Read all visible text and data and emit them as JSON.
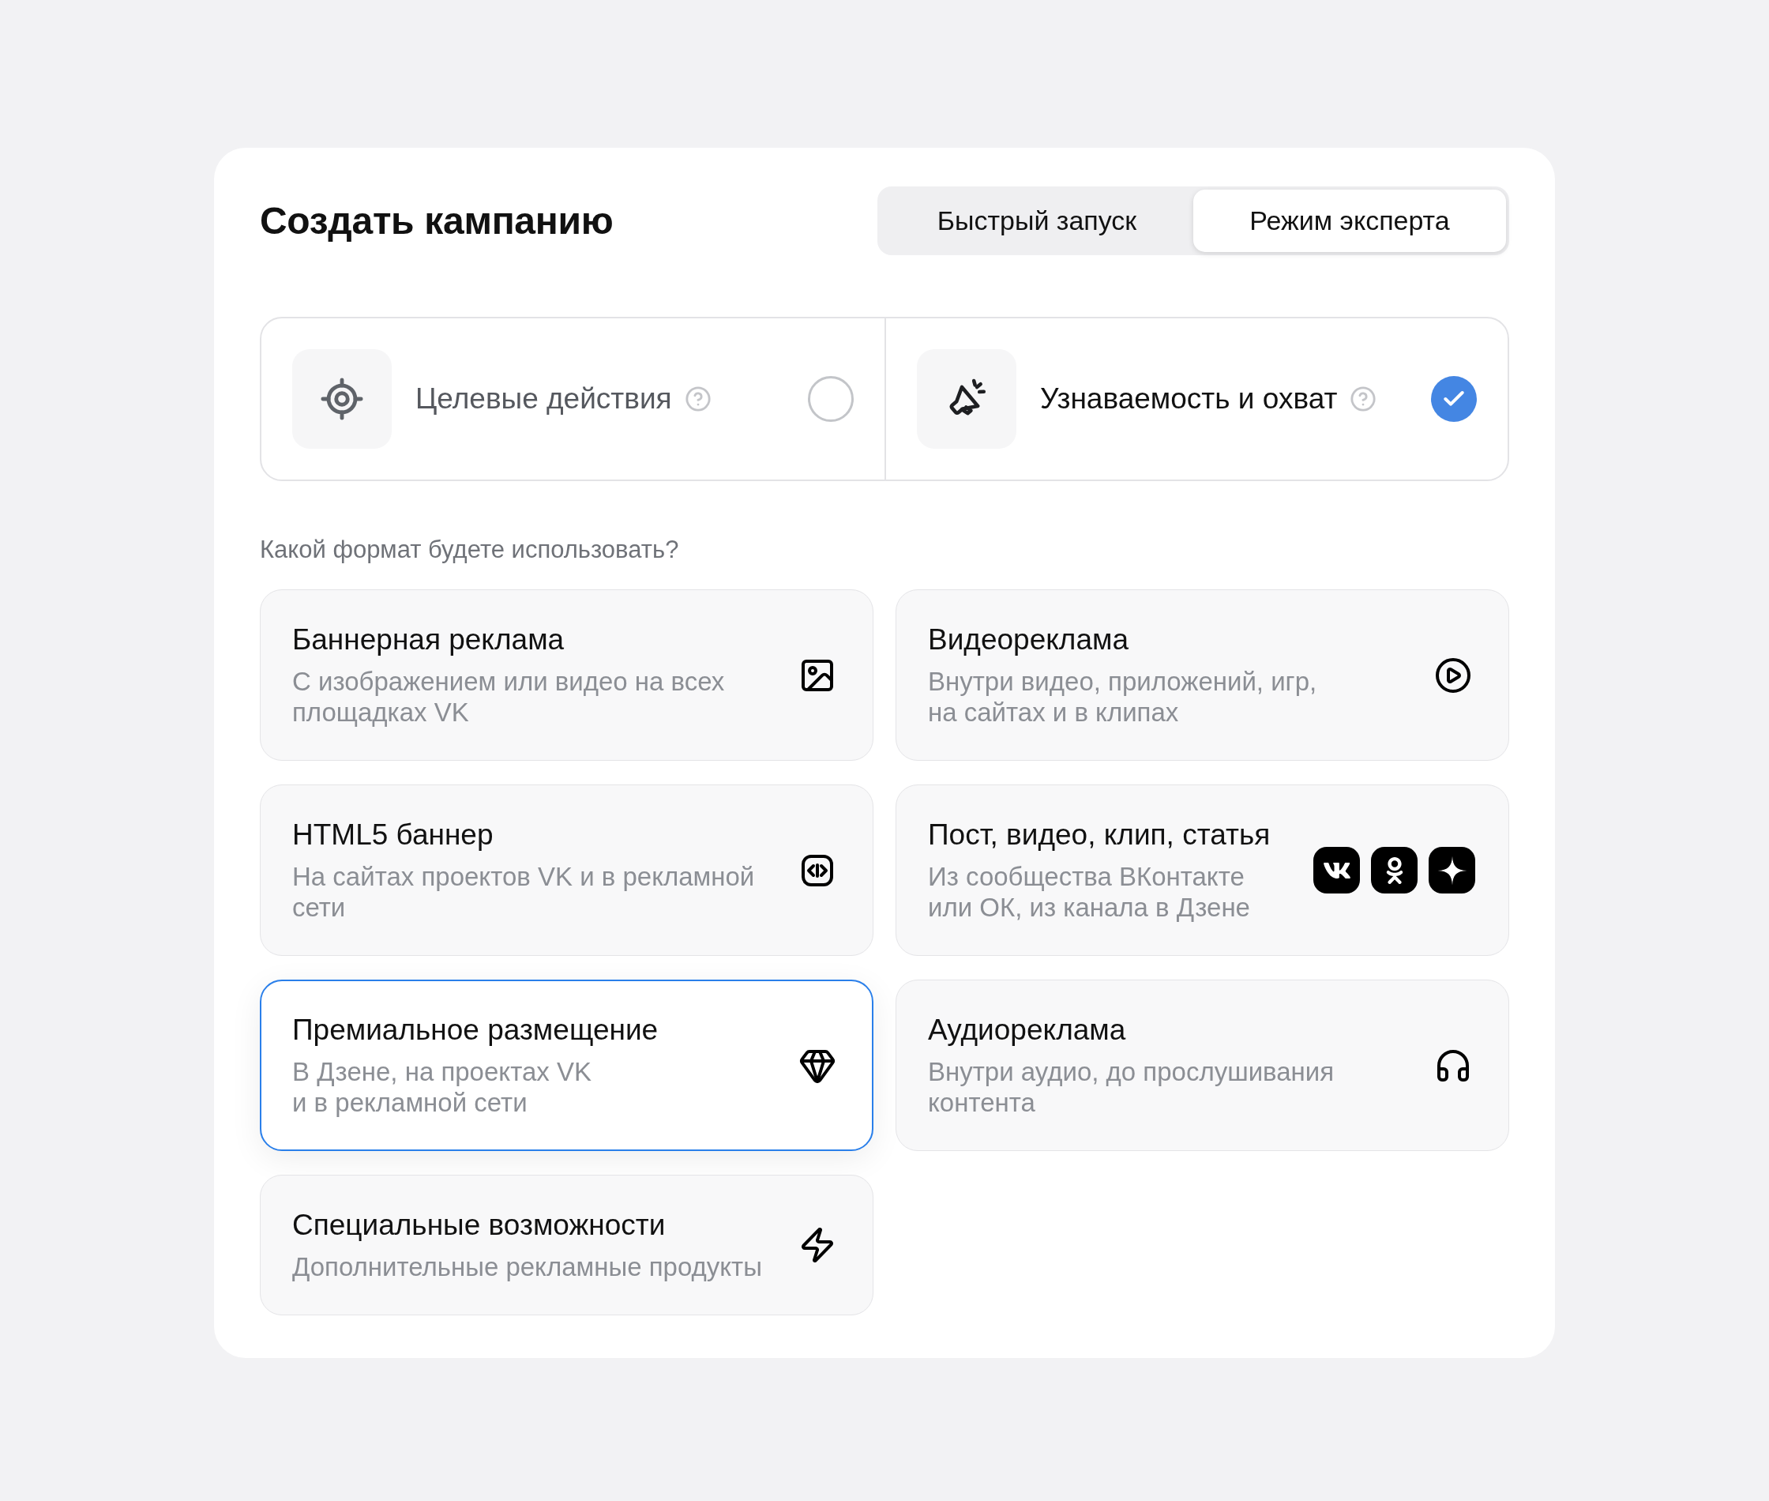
{
  "title": "Создать кампанию",
  "mode_tabs": [
    {
      "label": "Быстрый запуск",
      "selected": false
    },
    {
      "label": "Режим эксперта",
      "selected": true
    }
  ],
  "goals": [
    {
      "kind": "target",
      "label": "Целевые действия",
      "selected": false
    },
    {
      "kind": "megaphone",
      "label": "Узнаваемость и охват",
      "selected": true
    }
  ],
  "format_question": "Какой формат будете использовать?",
  "formats": [
    {
      "kind": "image",
      "title": "Баннерная реклама",
      "description": "С изображением или видео на всех\nплощадках VK",
      "selected": false
    },
    {
      "kind": "video",
      "title": "Видеореклама",
      "description": "Внутри видео, приложений, игр,\nна сайтах и в клипах",
      "selected": false
    },
    {
      "kind": "code",
      "title": "HTML5 баннер",
      "description": "На сайтах проектов VK и в рекламной\nсети",
      "selected": false
    },
    {
      "kind": "social",
      "title": "Пост, видео, клип, статья",
      "description": "Из сообщества ВКонтакте\nили ОК, из канала в Дзене",
      "selected": false
    },
    {
      "kind": "diamond",
      "title": "Премиальное размещение",
      "description": "В Дзене, на проектах VK\nи в рекламной сети",
      "selected": true
    },
    {
      "kind": "audio",
      "title": "Аудиореклама",
      "description": "Внутри аудио, до прослушивания\nконтента",
      "selected": false
    },
    {
      "kind": "lightning",
      "title": "Специальные возможности",
      "description": "Дополнительные рекламные продукты",
      "selected": false
    }
  ]
}
